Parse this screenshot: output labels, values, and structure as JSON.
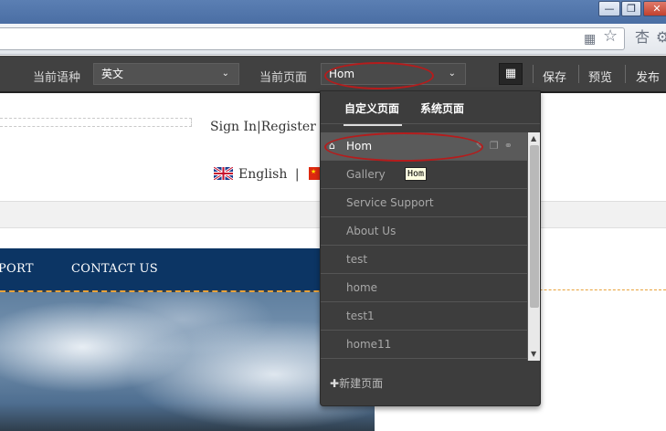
{
  "toolbar": {
    "lang_label": "当前语种",
    "lang_value": "英文",
    "page_label": "当前页面",
    "page_value": "Hom",
    "save": "保存",
    "preview": "预览",
    "publish": "发布"
  },
  "site": {
    "sign_in": "Sign In",
    "separator": "|",
    "register": "Register",
    "lang_english": "English",
    "lang_sep": "|",
    "nav": [
      "PORT",
      "CONTACT US"
    ]
  },
  "dropdown": {
    "tabs": [
      "自定义页面",
      "系统页面"
    ],
    "items": [
      "Hom",
      "Gallery",
      "Service Support",
      "About Us",
      "test",
      "home",
      "test1",
      "home11"
    ],
    "new_page": "新建页面",
    "tooltip": "Hom"
  },
  "colors": {
    "toolbar_bg": "#414141",
    "nav_bg": "#0c3564",
    "annotation_red": "#b51c1c"
  }
}
